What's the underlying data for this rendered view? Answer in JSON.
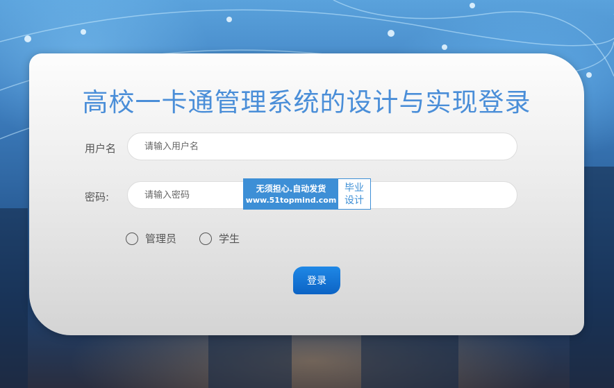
{
  "page": {
    "title": "高校一卡通管理系统的设计与实现登录"
  },
  "form": {
    "username_label": "用户名",
    "username_placeholder": "请输入用户名",
    "password_label": "密码:",
    "password_placeholder": "请输入密码",
    "roles": [
      {
        "label": "管理员",
        "selected": false
      },
      {
        "label": "学生",
        "selected": false
      }
    ],
    "login_label": "登录"
  },
  "watermark": {
    "line1": "无须担心.自动发货",
    "line2": "www.51topmind.com",
    "side_line1": "毕业",
    "side_line2": "设计"
  },
  "colors": {
    "title": "#4a8ed8",
    "button": "#1f88e6",
    "watermark": "#3d8fd6"
  }
}
